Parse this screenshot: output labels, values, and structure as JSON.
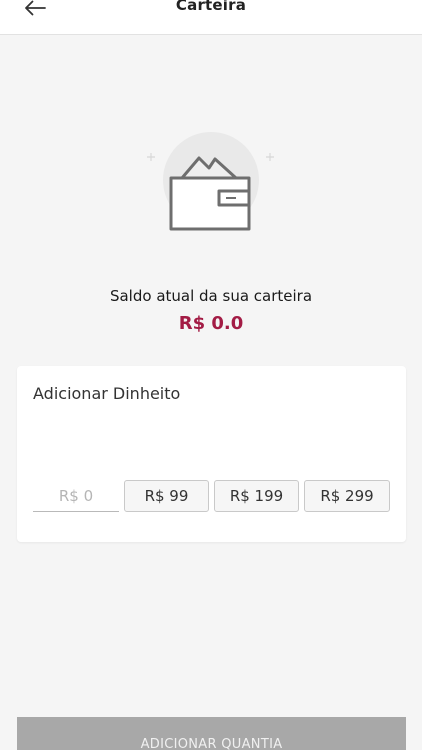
{
  "header": {
    "title": "Carteira",
    "back_icon": "arrow-left-icon"
  },
  "illustration": {
    "icon": "wallet-icon",
    "sparkle_icon": "plus-sparkle-icon"
  },
  "balance": {
    "label": "Saldo atual da sua carteira",
    "value": "R$ 0.0",
    "value_color": "#a31c45"
  },
  "add_money": {
    "title": "Adicionar Dinheito",
    "input_placeholder": "R$ 0",
    "input_value": "",
    "quick_amounts": [
      "R$ 99",
      "R$ 199",
      "R$ 299"
    ]
  },
  "footer": {
    "submit_label": "ADICIONAR QUANTIA"
  }
}
